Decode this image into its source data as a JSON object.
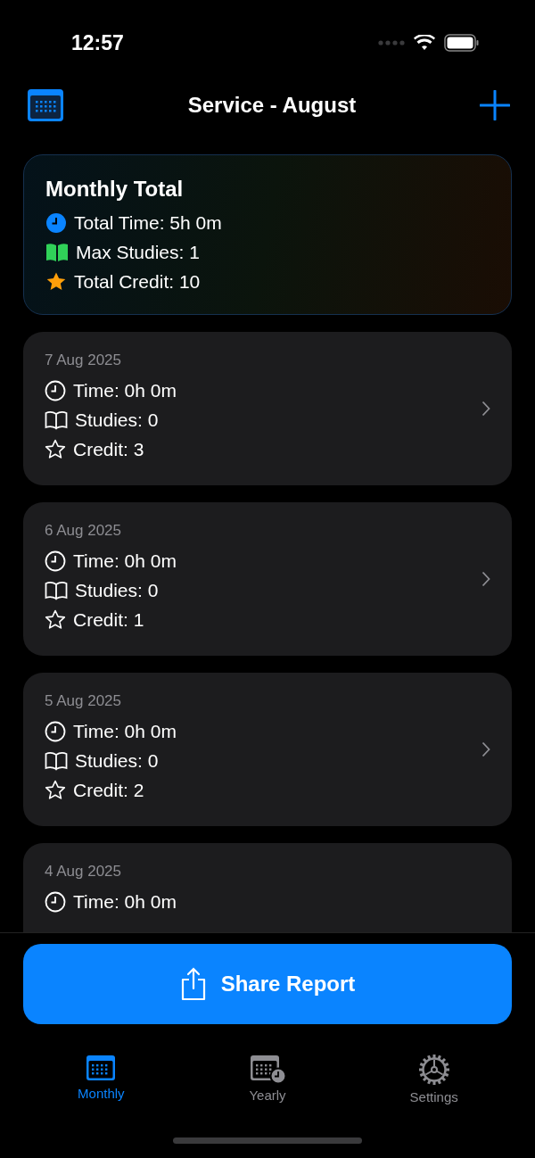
{
  "status_bar": {
    "time": "12:57"
  },
  "header": {
    "title": "Service - August"
  },
  "summary": {
    "title": "Monthly Total",
    "rows": [
      {
        "kind": "time",
        "text": "Total Time: 5h 0m"
      },
      {
        "kind": "studies",
        "text": "Max Studies: 1"
      },
      {
        "kind": "credit",
        "text": "Total Credit: 10"
      }
    ]
  },
  "days": [
    {
      "date": "7 Aug 2025",
      "rows": [
        {
          "kind": "time",
          "text": "Time: 0h 0m"
        },
        {
          "kind": "studies",
          "text": "Studies: 0"
        },
        {
          "kind": "credit",
          "text": "Credit: 3"
        }
      ]
    },
    {
      "date": "6 Aug 2025",
      "rows": [
        {
          "kind": "time",
          "text": "Time: 0h 0m"
        },
        {
          "kind": "studies",
          "text": "Studies: 0"
        },
        {
          "kind": "credit",
          "text": "Credit: 1"
        }
      ]
    },
    {
      "date": "5 Aug 2025",
      "rows": [
        {
          "kind": "time",
          "text": "Time: 0h 0m"
        },
        {
          "kind": "studies",
          "text": "Studies: 0"
        },
        {
          "kind": "credit",
          "text": "Credit: 2"
        }
      ]
    },
    {
      "date": "4 Aug 2025",
      "rows": [
        {
          "kind": "time",
          "text": "Time: 0h 0m"
        }
      ]
    }
  ],
  "share_button": {
    "label": "Share Report"
  },
  "tabs": [
    {
      "kind": "monthly",
      "label": "Monthly",
      "selected": true
    },
    {
      "kind": "yearly",
      "label": "Yearly",
      "selected": false
    },
    {
      "kind": "settings",
      "label": "Settings",
      "selected": false
    }
  ]
}
